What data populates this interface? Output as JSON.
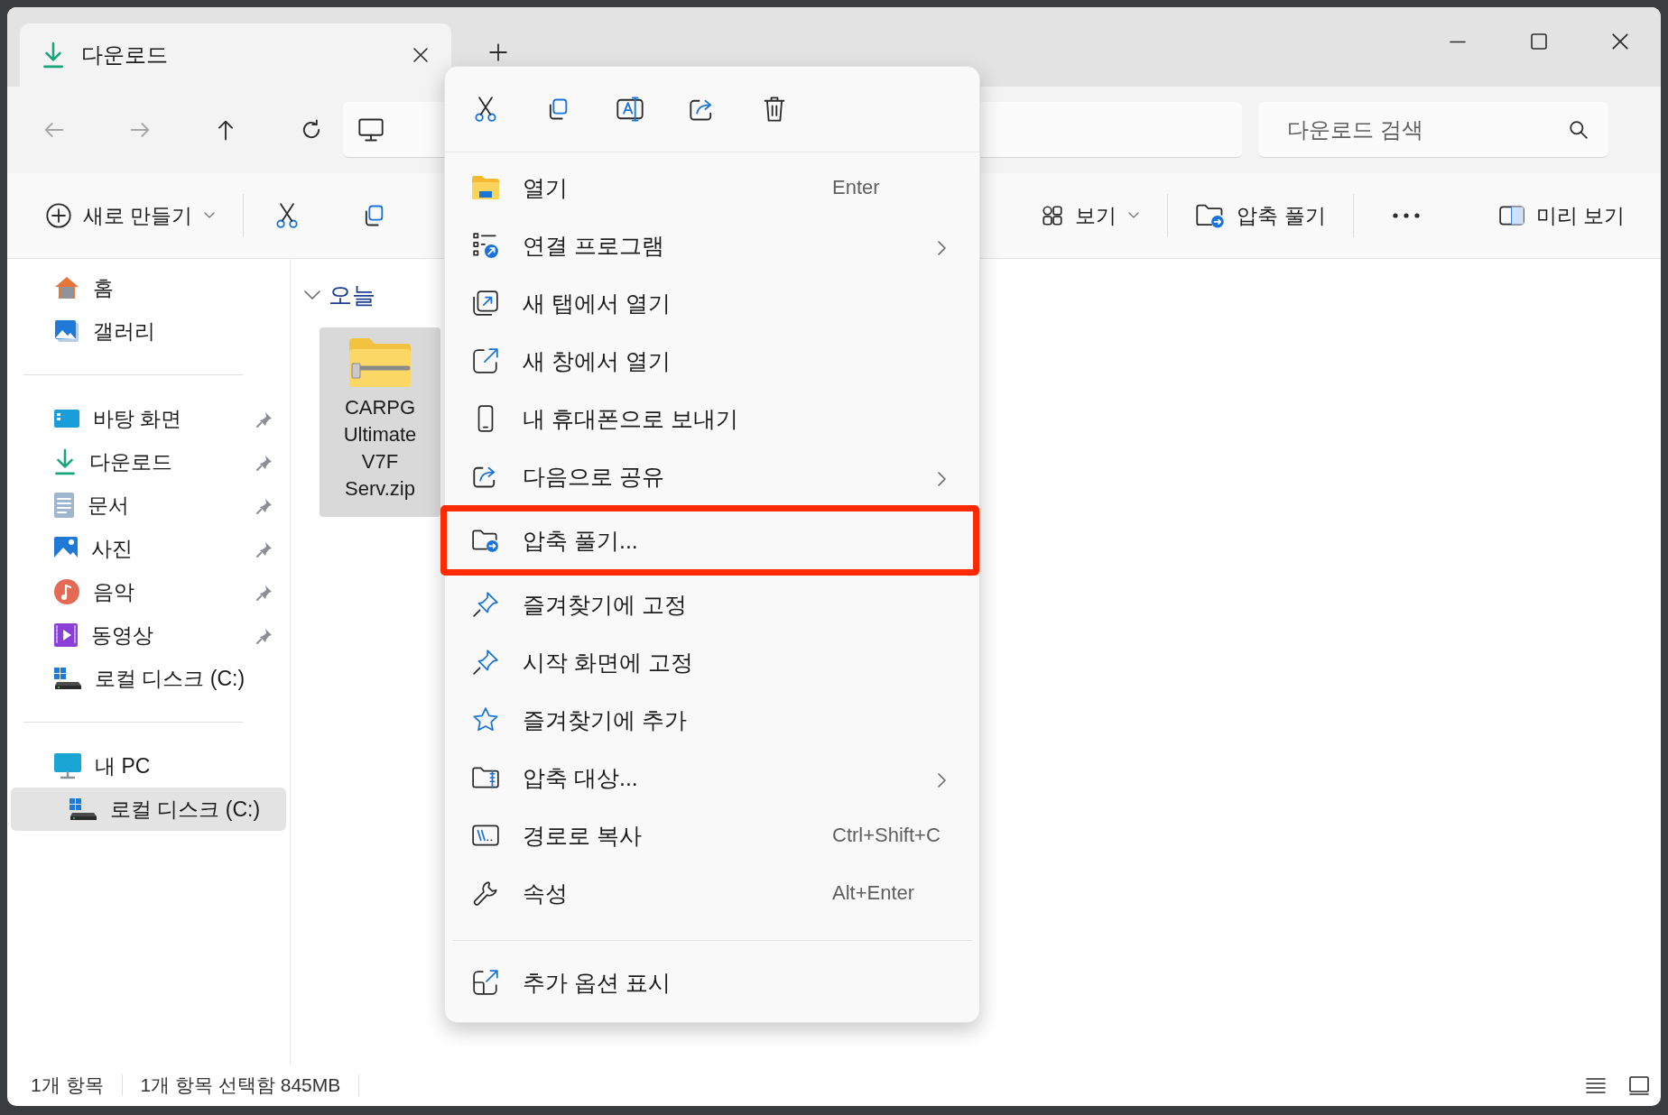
{
  "tabs": [
    {
      "title": "다운로드",
      "selected": true
    }
  ],
  "navigation": [
    {
      "disabled": true
    },
    {
      "disabled": true
    },
    {
      "disabled": false
    },
    {
      "disabled": false
    }
  ],
  "search": {
    "placeholder": "다운로드 검색"
  },
  "command_bar": {
    "new": {
      "label": "새로 만들기"
    },
    "view": {
      "label": "보기"
    },
    "extract": {
      "label": "압축 풀기"
    },
    "preview": {
      "label": "미리 보기"
    }
  },
  "sidebar": {
    "sections": [
      {
        "items": [
          {
            "label": "홈",
            "pinned": false,
            "selected": false
          },
          {
            "label": "갤러리",
            "pinned": false,
            "selected": false
          }
        ]
      },
      {
        "items": [
          {
            "label": "바탕 화면",
            "pinned": true,
            "selected": false
          },
          {
            "label": "다운로드",
            "pinned": true,
            "selected": false
          },
          {
            "label": "문서",
            "pinned": true,
            "selected": false
          },
          {
            "label": "사진",
            "pinned": true,
            "selected": false
          },
          {
            "label": "음악",
            "pinned": true,
            "selected": false
          },
          {
            "label": "동영상",
            "pinned": true,
            "selected": false
          },
          {
            "label": "로컬 디스크 (C:)",
            "pinned": false,
            "selected": false
          }
        ]
      },
      {
        "items": [
          {
            "label": "내 PC",
            "pinned": false,
            "selected": false,
            "children": [
              {
                "label": "로컬 디스크 (C:)",
                "pinned": false,
                "selected": true
              }
            ]
          }
        ]
      }
    ]
  },
  "content": {
    "groups": [
      {
        "label": "오늘",
        "expanded": true,
        "files": [
          {
            "name": "CARPG Ultimate V7F Serv.zip",
            "selected": true
          }
        ]
      }
    ]
  },
  "context_menu": {
    "sections": [
      {
        "items": [
          {
            "label": "열기",
            "shortcut": "Enter",
            "submenu": false,
            "marked": false
          },
          {
            "label": "연결 프로그램",
            "submenu": true,
            "marked": false
          },
          {
            "label": "새 탭에서 열기",
            "submenu": false,
            "marked": false
          },
          {
            "label": "새 창에서 열기",
            "submenu": false,
            "marked": false
          },
          {
            "label": "내 휴대폰으로 보내기",
            "submenu": false,
            "marked": false
          },
          {
            "label": "다음으로 공유",
            "submenu": true,
            "marked": false
          },
          {
            "label": "압축 풀기...",
            "submenu": false,
            "marked": true
          },
          {
            "label": "즐겨찾기에 고정",
            "submenu": false,
            "marked": false
          },
          {
            "label": "시작 화면에 고정",
            "submenu": false,
            "marked": false
          },
          {
            "label": "즐겨찾기에 추가",
            "submenu": false,
            "marked": false
          },
          {
            "label": "압축 대상...",
            "submenu": true,
            "marked": false
          },
          {
            "label": "경로로 복사",
            "shortcut": "Ctrl+Shift+C",
            "submenu": false,
            "marked": false
          },
          {
            "label": "속성",
            "shortcut": "Alt+Enter",
            "submenu": false,
            "marked": false
          }
        ]
      },
      {
        "items": [
          {
            "label": "추가 옵션 표시",
            "submenu": false,
            "marked": false
          }
        ]
      }
    ]
  },
  "status_bar": {
    "item_count": "1개 항목",
    "selection": "1개 항목 선택함 845MB"
  }
}
